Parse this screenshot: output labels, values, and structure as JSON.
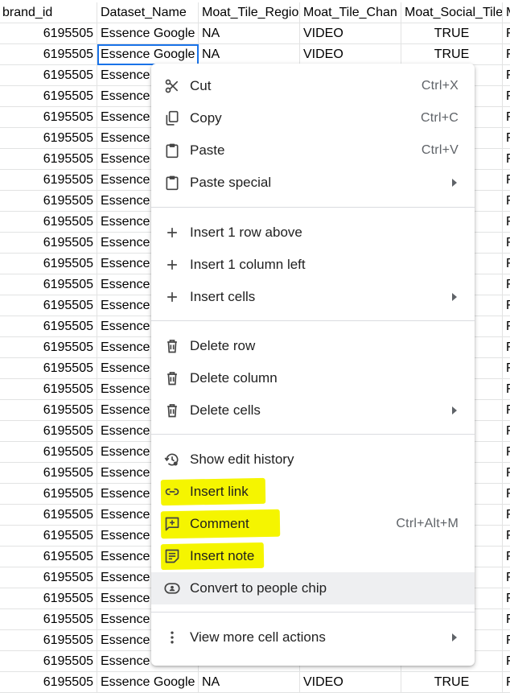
{
  "columns": {
    "brand_id": "brand_id",
    "dataset_name": "Dataset_Name",
    "region": "Moat_Tile_Regio",
    "channel": "Moat_Tile_Chan",
    "social": "Moat_Social_Tile",
    "extra": "M"
  },
  "rows": [
    {
      "brand_id": "6195505",
      "dataset": "Essence Google",
      "region": "NA",
      "channel": "VIDEO",
      "social": "TRUE",
      "extra": "F"
    },
    {
      "brand_id": "6195505",
      "dataset": "Essence Google",
      "region": "NA",
      "channel": "VIDEO",
      "social": "TRUE",
      "extra": "F"
    },
    {
      "brand_id": "6195505",
      "dataset": "Essence",
      "extra": "F"
    },
    {
      "brand_id": "6195505",
      "dataset": "Essence",
      "extra": "F"
    },
    {
      "brand_id": "6195505",
      "dataset": "Essence",
      "extra": "F"
    },
    {
      "brand_id": "6195505",
      "dataset": "Essence",
      "extra": "F"
    },
    {
      "brand_id": "6195505",
      "dataset": "Essence",
      "extra": "F"
    },
    {
      "brand_id": "6195505",
      "dataset": "Essence",
      "extra": "F"
    },
    {
      "brand_id": "6195505",
      "dataset": "Essence",
      "extra": "F"
    },
    {
      "brand_id": "6195505",
      "dataset": "Essence",
      "extra": "F"
    },
    {
      "brand_id": "6195505",
      "dataset": "Essence",
      "extra": "F"
    },
    {
      "brand_id": "6195505",
      "dataset": "Essence",
      "extra": "F"
    },
    {
      "brand_id": "6195505",
      "dataset": "Essence",
      "extra": "F"
    },
    {
      "brand_id": "6195505",
      "dataset": "Essence",
      "extra": "F"
    },
    {
      "brand_id": "6195505",
      "dataset": "Essence",
      "extra": "F"
    },
    {
      "brand_id": "6195505",
      "dataset": "Essence",
      "extra": "F"
    },
    {
      "brand_id": "6195505",
      "dataset": "Essence",
      "extra": "F"
    },
    {
      "brand_id": "6195505",
      "dataset": "Essence",
      "extra": "F"
    },
    {
      "brand_id": "6195505",
      "dataset": "Essence",
      "extra": "F"
    },
    {
      "brand_id": "6195505",
      "dataset": "Essence",
      "extra": "F"
    },
    {
      "brand_id": "6195505",
      "dataset": "Essence",
      "extra": "F"
    },
    {
      "brand_id": "6195505",
      "dataset": "Essence",
      "extra": "F"
    },
    {
      "brand_id": "6195505",
      "dataset": "Essence",
      "extra": "F"
    },
    {
      "brand_id": "6195505",
      "dataset": "Essence",
      "extra": "F"
    },
    {
      "brand_id": "6195505",
      "dataset": "Essence",
      "extra": "F"
    },
    {
      "brand_id": "6195505",
      "dataset": "Essence",
      "extra": "F"
    },
    {
      "brand_id": "6195505",
      "dataset": "Essence",
      "extra": "F"
    },
    {
      "brand_id": "6195505",
      "dataset": "Essence",
      "extra": "F"
    },
    {
      "brand_id": "6195505",
      "dataset": "Essence",
      "extra": "F"
    },
    {
      "brand_id": "6195505",
      "dataset": "Essence",
      "extra": "F"
    },
    {
      "brand_id": "6195505",
      "dataset": "Essence",
      "extra": "F"
    },
    {
      "brand_id": "6195505",
      "dataset": "Essence Google",
      "region": "NA",
      "channel": "VIDEO",
      "social": "TRUE",
      "extra": "F"
    }
  ],
  "menu": {
    "cut": {
      "label": "Cut",
      "shortcut": "Ctrl+X",
      "icon": "scissors-icon"
    },
    "copy": {
      "label": "Copy",
      "shortcut": "Ctrl+C",
      "icon": "copy-icon"
    },
    "paste": {
      "label": "Paste",
      "shortcut": "Ctrl+V",
      "icon": "clipboard-icon"
    },
    "paste_special": {
      "label": "Paste special",
      "icon": "clipboard-icon"
    },
    "insert_row": {
      "label": "Insert 1 row above",
      "icon": "plus-icon"
    },
    "insert_col": {
      "label": "Insert 1 column left",
      "icon": "plus-icon"
    },
    "insert_cells": {
      "label": "Insert cells",
      "icon": "plus-icon"
    },
    "delete_row": {
      "label": "Delete row",
      "icon": "trash-icon"
    },
    "delete_col": {
      "label": "Delete column",
      "icon": "trash-icon"
    },
    "delete_cells": {
      "label": "Delete cells",
      "icon": "trash-icon"
    },
    "edit_history": {
      "label": "Show edit history",
      "icon": "history-icon"
    },
    "insert_link": {
      "label": "Insert link",
      "icon": "link-icon"
    },
    "comment": {
      "label": "Comment",
      "shortcut": "Ctrl+Alt+M",
      "icon": "comment-add-icon"
    },
    "insert_note": {
      "label": "Insert note",
      "icon": "note-icon"
    },
    "people_chip": {
      "label": "Convert to people chip",
      "icon": "person-chip-icon"
    },
    "more_actions": {
      "label": "View more cell actions",
      "icon": "more-vert-icon"
    }
  },
  "colors": {
    "highlight": "#f5f500",
    "selection": "#1a73e8",
    "hover": "#eeeff1"
  }
}
